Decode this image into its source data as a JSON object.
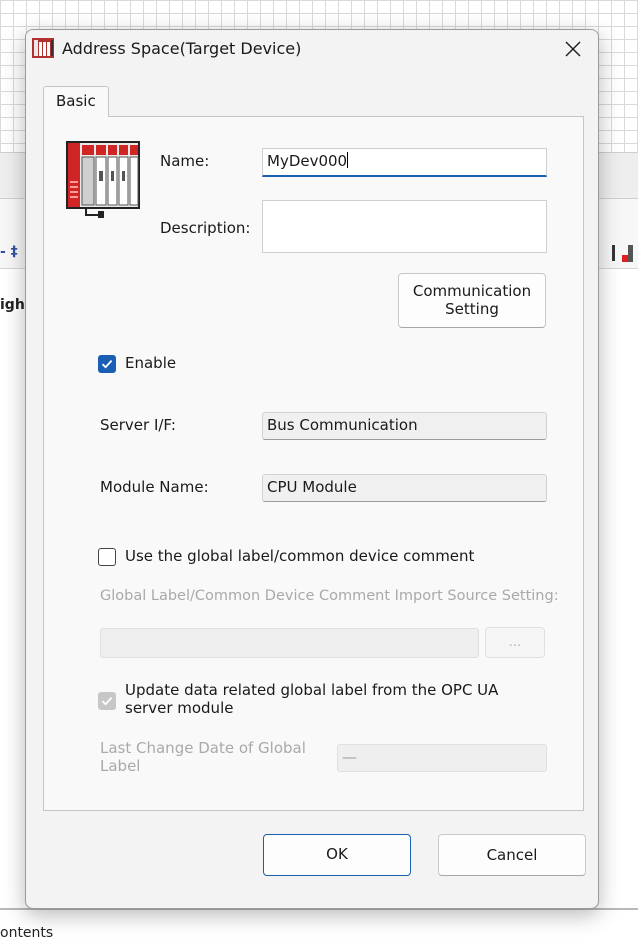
{
  "background": {
    "left_fragment": "igh",
    "bottom_fragment": "ontents",
    "toolbar_glyph": "- ‡"
  },
  "dialog": {
    "title": "Address Space(Target Device)",
    "tab_basic": "Basic",
    "name_label": "Name:",
    "name_value": "MyDev000",
    "description_label": "Description:",
    "description_value": "",
    "communication_setting_line1": "Communication",
    "communication_setting_line2": "Setting",
    "enable_label": "Enable",
    "enable_checked": true,
    "server_if_label": "Server I/F:",
    "server_if_value": "Bus Communication",
    "module_name_label": "Module Name:",
    "module_name_value": "CPU Module",
    "use_global_label": "Use the global label/common device comment",
    "use_global_checked": false,
    "import_source_label": "Global Label/Common Device Comment Import Source Setting:",
    "import_source_value": "",
    "browse_label": "...",
    "update_label_line1": "Update data related global label from the OPC UA",
    "update_label_line2": "server module",
    "update_checked": true,
    "last_change_label_line1": "Last Change Date of Global",
    "last_change_label_line2": "Label",
    "last_change_value": "—",
    "ok_label": "OK",
    "cancel_label": "Cancel"
  },
  "colors": {
    "accent": "#1a5fb4",
    "dialog_bg": "#f3f3f3",
    "disabled_text": "#a9a9a9"
  },
  "icons": [
    "plc-device-icon",
    "close-icon",
    "check-icon",
    "app-device-icon"
  ]
}
